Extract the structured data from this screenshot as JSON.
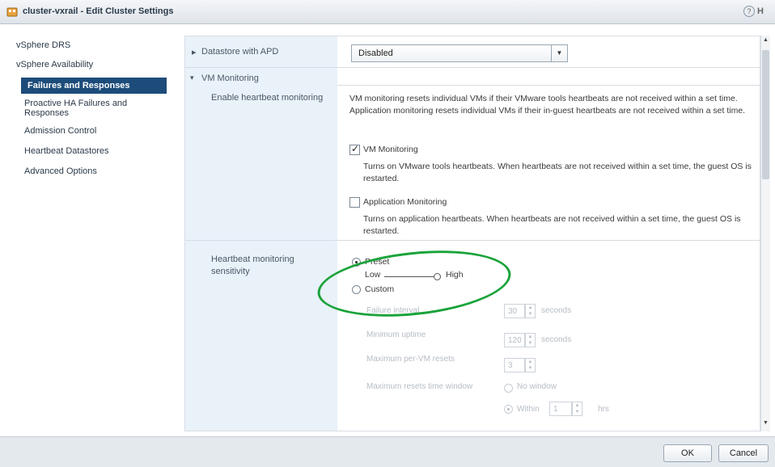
{
  "window": {
    "title": "cluster-vxrail - Edit Cluster Settings",
    "help_label": "?",
    "help_extra": "H"
  },
  "nav": {
    "items": [
      {
        "label": "vSphere DRS"
      },
      {
        "label": "vSphere Availability"
      },
      {
        "label": "Failures and Responses"
      },
      {
        "label": "Proactive HA Failures and Responses"
      },
      {
        "label": "Admission Control"
      },
      {
        "label": "Heartbeat Datastores"
      },
      {
        "label": "Advanced Options"
      }
    ]
  },
  "main": {
    "datastore_apd": {
      "label": "Datastore with APD",
      "value": "Disabled"
    },
    "vm_monitoring_section": "VM Monitoring",
    "enable_heartbeat": {
      "label": "Enable heartbeat monitoring",
      "description": "VM monitoring resets individual VMs if their VMware tools heartbeats are not received within a set time. Application monitoring resets individual VMs if their in-guest heartbeats are not received within a set time.",
      "vm_monitoring": {
        "label": "VM Monitoring",
        "checked": true,
        "description": "Turns on VMware tools heartbeats. When heartbeats are not received within a set time, the guest OS is restarted."
      },
      "app_monitoring": {
        "label": "Application Monitoring",
        "checked": false,
        "description": "Turns on application heartbeats. When heartbeats are not received within a set time, the guest OS is restarted."
      }
    },
    "sensitivity": {
      "label": "Heartbeat monitoring sensitivity",
      "preset_label": "Preset",
      "low_label": "Low",
      "high_label": "High",
      "level": 1.0,
      "custom_label": "Custom",
      "failure_interval": {
        "label": "Failure interval",
        "value": "30",
        "unit": "seconds"
      },
      "minimum_uptime": {
        "label": "Minimum uptime",
        "value": "120",
        "unit": "seconds"
      },
      "max_resets": {
        "label": "Maximum per-VM resets",
        "value": "3"
      },
      "max_resets_window": {
        "label": "Maximum resets time window",
        "no_window": "No window",
        "within": "Within",
        "within_value": "1",
        "unit": "hrs"
      }
    },
    "highlight_color": "#1aa33a"
  },
  "footer": {
    "ok": "OK",
    "cancel": "Cancel"
  }
}
